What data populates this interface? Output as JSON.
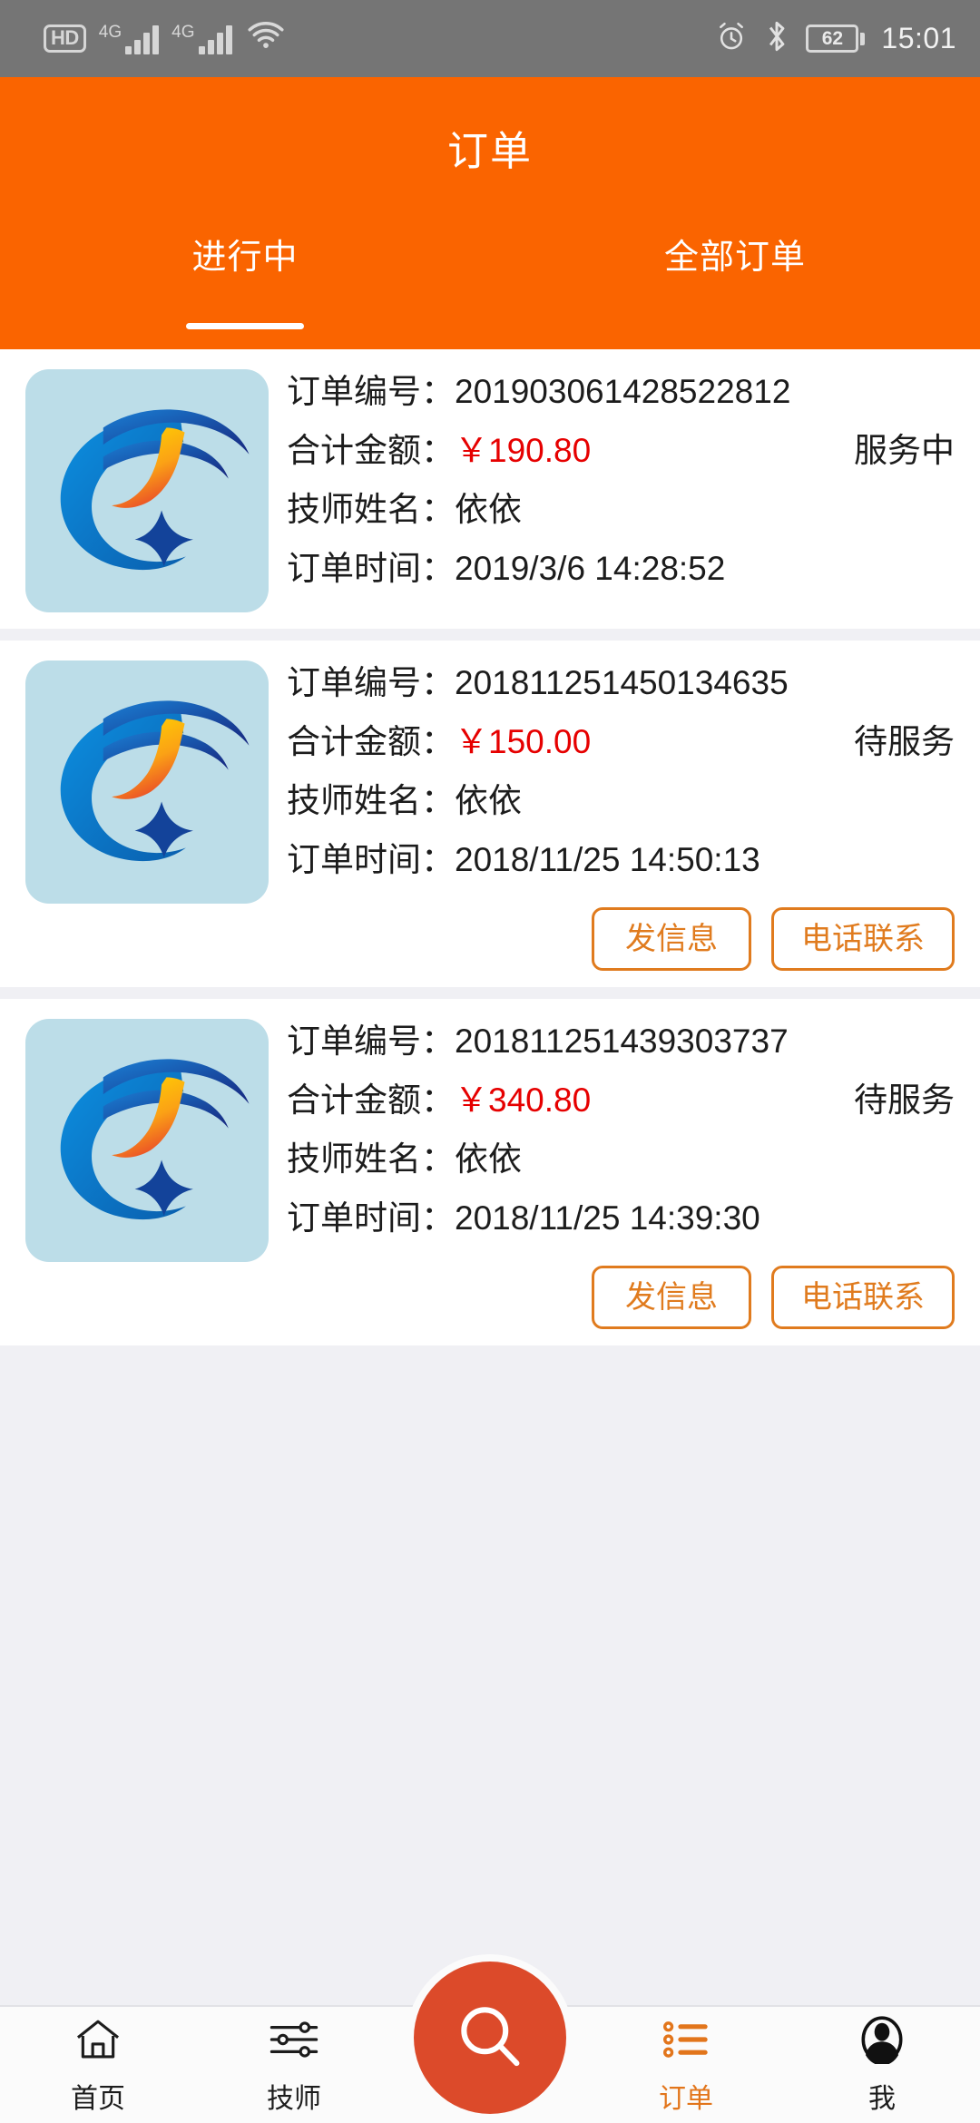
{
  "statusbar": {
    "hd_badge": "HD",
    "network1": "4G",
    "network2": "4G",
    "wifi_icon": "wifi-icon",
    "alarm_icon": "alarm-clock-icon",
    "bluetooth_icon": "bluetooth-icon",
    "battery_level": "62",
    "time": "15:01"
  },
  "header": {
    "title": "订单",
    "tabs": [
      {
        "label": "进行中",
        "active": true
      },
      {
        "label": "全部订单",
        "active": false
      }
    ]
  },
  "labels": {
    "order_no": "订单编号：",
    "total_amount": "合计金额：",
    "technician": "技师姓名：",
    "order_time": "订单时间："
  },
  "orders": [
    {
      "order_no": "201903061428522812",
      "amount": "￥190.80",
      "status": "服务中",
      "technician": "依依",
      "time": "2019/3/6 14:28:52",
      "has_actions": false
    },
    {
      "order_no": "201811251450134635",
      "amount": "￥150.00",
      "status": "待服务",
      "technician": "依依",
      "time": "2018/11/25 14:50:13",
      "has_actions": true
    },
    {
      "order_no": "201811251439303737",
      "amount": "￥340.80",
      "status": "待服务",
      "technician": "依依",
      "time": "2018/11/25 14:39:30",
      "has_actions": true
    }
  ],
  "buttons": {
    "send_message": "发信息",
    "phone_contact": "电话联系"
  },
  "bottom_nav": {
    "items": [
      {
        "label": "首页",
        "icon": "home-icon",
        "active": false
      },
      {
        "label": "技师",
        "icon": "sliders-icon",
        "active": false
      },
      {
        "label": "订单",
        "icon": "list-icon",
        "active": true
      },
      {
        "label": "我",
        "icon": "person-icon",
        "active": false
      }
    ],
    "fab_icon": "search-icon"
  },
  "colors": {
    "header_orange": "#fa6400",
    "accent_orange": "#e07b1e",
    "price_red": "#e60000",
    "fab_red": "#dc4a2a",
    "logo_bg": "#bcdde8"
  }
}
